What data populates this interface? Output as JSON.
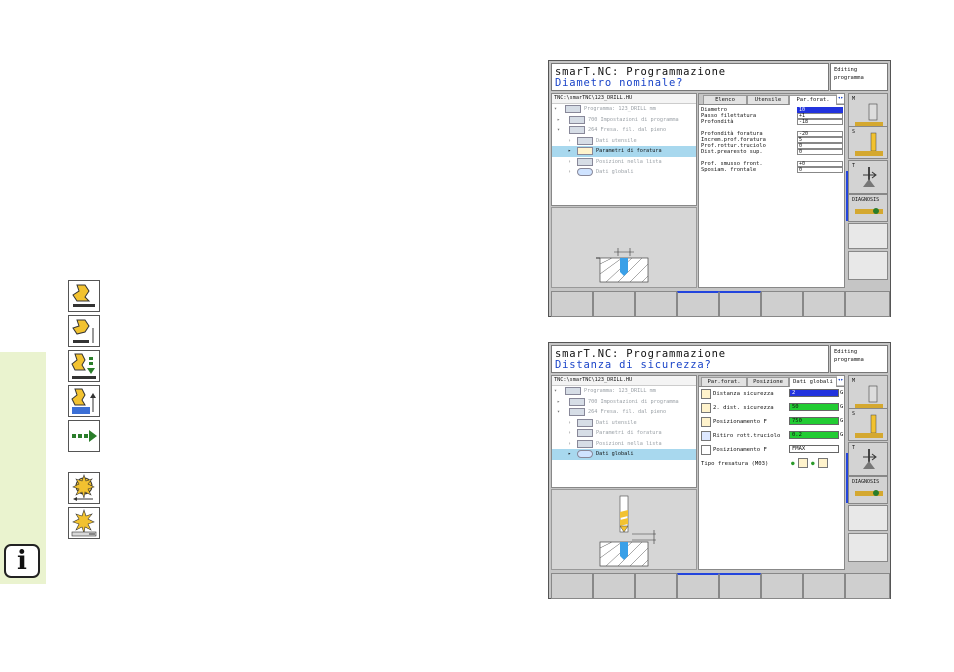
{
  "sidebar": {
    "info_glyph": "i",
    "accent": "#eaf3cf"
  },
  "cycle_icons": [
    "drill-plunge-icon",
    "drill-dwell-icon",
    "drill-chipbreak-icon",
    "drill-retract-icon",
    "rapid-arrow-icon",
    "mill-circular-icon",
    "mill-face-icon"
  ],
  "screen1": {
    "title": "smarT.NC: Programmazione",
    "prompt": "Diametro nominale?",
    "mode": [
      "Editing",
      "programma"
    ],
    "path": "TNC:\\smarTNC\\123_DRILL.HU",
    "tree": [
      {
        "label": "Programma: 123_DRILL mm",
        "state": "grey"
      },
      {
        "label": "700 Impostazioni di programma",
        "state": "grey"
      },
      {
        "label": "264 Fresa. fil. dal pieno",
        "state": "grey"
      },
      {
        "label": "Dati utensile",
        "state": "grey"
      },
      {
        "label": "Parametri di foratura",
        "state": "selected"
      },
      {
        "label": "Posizioni nella lista",
        "state": "grey"
      },
      {
        "label": "Dati globali",
        "state": "grey"
      }
    ],
    "tabs": [
      "Elenco",
      "Utensile",
      "Par.forat."
    ],
    "fields": [
      {
        "label": "Diametro",
        "value": "10",
        "hl": true
      },
      {
        "label": "Passo filettatura",
        "value": "+1"
      },
      {
        "label": "Profondità",
        "value": "-18"
      },
      {
        "label": "",
        "value": ""
      },
      {
        "label": "Profondità foratura",
        "value": "-20"
      },
      {
        "label": "Increm.prof.foratura",
        "value": "5"
      },
      {
        "label": "Prof.rottur.truciolo",
        "value": "0"
      },
      {
        "label": "Dist.prearesto sup.",
        "value": "0"
      },
      {
        "label": "",
        "value": ""
      },
      {
        "label": "Prof. smusso front.",
        "value": "+0"
      },
      {
        "label": "Sposiam. frontale",
        "value": "0"
      }
    ],
    "vkeys": [
      "M",
      "S",
      "T",
      "DIAGNOSIS"
    ]
  },
  "screen2": {
    "title": "smarT.NC: Programmazione",
    "prompt": "Distanza di sicurezza?",
    "mode": [
      "Editing",
      "programma"
    ],
    "path": "TNC:\\smarTNC\\123_DRILL.HU",
    "tree": [
      {
        "label": "Programma: 123_DRILL mm",
        "state": "grey"
      },
      {
        "label": "700 Impostazioni di programma",
        "state": "grey"
      },
      {
        "label": "264 Fresa. fil. dal pieno",
        "state": "grey"
      },
      {
        "label": "Dati utensile",
        "state": "grey"
      },
      {
        "label": "Parametri di foratura",
        "state": "grey"
      },
      {
        "label": "Posizioni nella lista",
        "state": "grey"
      },
      {
        "label": "Dati globali",
        "state": "selected"
      }
    ],
    "tabs": [
      "Par.forat.",
      "Posizione",
      "Dati globali"
    ],
    "fields": [
      {
        "label": "Distanza sicurezza",
        "value": "2",
        "color": "blue",
        "suffix": "G"
      },
      {
        "label": "2. dist. sicurezza",
        "value": "50",
        "color": "green",
        "suffix": "G"
      },
      {
        "label": "Posizionamento F",
        "value": "750",
        "color": "green",
        "suffix": "G"
      },
      {
        "label": "Ritiro rott.truciolo",
        "value": "0.2",
        "color": "green",
        "suffix": "G"
      },
      {
        "label": "Posizionamento F",
        "value": "FMAX",
        "color": "white",
        "suffix": ""
      }
    ],
    "milling_label": "Tipo fresatura (M03)",
    "vkeys": [
      "M",
      "S",
      "T",
      "DIAGNOSIS"
    ]
  }
}
